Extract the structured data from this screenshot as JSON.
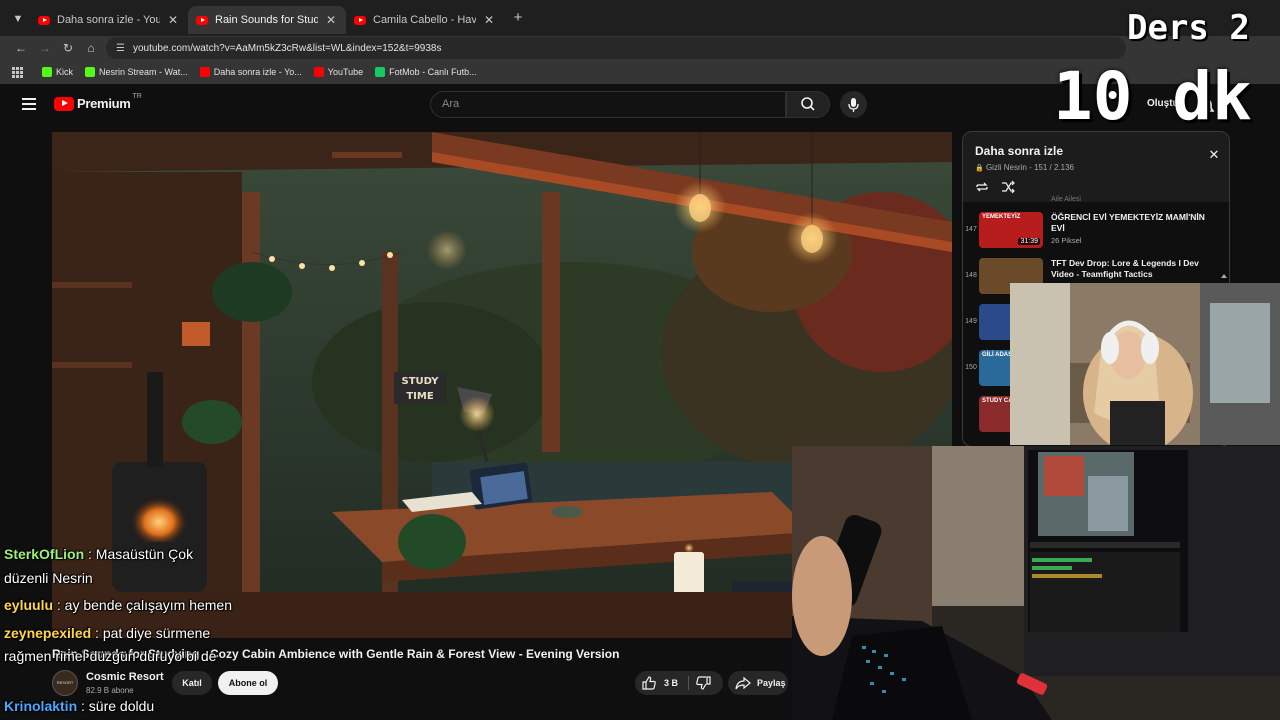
{
  "browser": {
    "tabs": [
      {
        "title": "Daha sonra izle - YouTube",
        "active": false
      },
      {
        "title": "Rain Sounds for Studying - Coz",
        "active": true
      },
      {
        "title": "Camila Cabello - Havana (Lyric",
        "active": false
      }
    ],
    "new_tab": "+",
    "url": "youtube.com/watch?v=AaMm5kZ3cRw&list=WL&index=152&t=9938s",
    "bookmarks": [
      {
        "label": "Kick",
        "color": "#53fc18"
      },
      {
        "label": "Nesrin Stream - Wat...",
        "color": "#53fc18"
      },
      {
        "label": "Daha sonra izle - Yo...",
        "color": "#ff0000"
      },
      {
        "label": "YouTube",
        "color": "#ff0000"
      },
      {
        "label": "FotMob - Canlı Futb...",
        "color": "#17c964"
      }
    ]
  },
  "youtube": {
    "logo_text": "Premium",
    "country": "TR",
    "search_placeholder": "Ara",
    "create_label": "Oluştur",
    "video": {
      "title": "Rain Sounds for Studying - Cozy Cabin Ambience with Gentle Rain & Forest View - Evening Version",
      "sign_line1": "STUDY",
      "sign_line2": "TIME",
      "channel_avatar_text": "RESORT",
      "channel_name": "Cosmic Resort",
      "channel_subs": "82.9 B abone",
      "join_label": "Katıl",
      "subscribe_label": "Abone ol",
      "like_count": "3 B",
      "share_label": "Paylaş"
    },
    "playlist": {
      "title": "Daha sonra izle",
      "meta": "Gizli Nesrin - 151 / 2.136",
      "cut_channel": "Aile Ailesi",
      "items": [
        {
          "index": "147",
          "title": "ÖĞRENCİ EVİ YEMEKTEYİZ MAMİ'NİN EVİ",
          "channel": "26 Piksel",
          "duration": "31:39",
          "thumb_text": "YEMEKTEYİZ",
          "thumb_color": "#b81d1d"
        },
        {
          "index": "148",
          "title": "TFT Dev Drop: Lore & Legends I Dev Video - Teamfight Tactics",
          "channel": "",
          "duration": "",
          "thumb_text": "",
          "thumb_color": "#6b4a2a"
        },
        {
          "index": "149",
          "title": "",
          "channel": "",
          "duration": "",
          "thumb_text": "",
          "thumb_color": "#2a4a8a"
        },
        {
          "index": "150",
          "title": "",
          "channel": "",
          "duration": "",
          "thumb_text": "GİLİ ADASI",
          "thumb_color": "#2a6a9a"
        },
        {
          "index": "",
          "title": "",
          "channel": "",
          "duration": "",
          "thumb_text": "STUDY CAR",
          "thumb_color": "#8a2a2a"
        }
      ]
    }
  },
  "overlay": {
    "ders_label": "Ders 2",
    "timer_label": "10 dk"
  },
  "chat": [
    {
      "user": "SterkOfLion",
      "color": "#9ef07a",
      "text": " : Masaüstün Çok",
      "cont": "düzenli Nesrin"
    },
    {
      "user": "eyluulu",
      "color": "#ffd84a",
      "text": " : ay bende çalışayım hemen",
      "cont": ""
    },
    {
      "user": "zeynepexiled",
      "color": "#ffd84a",
      "text": " : pat diye sürmene",
      "cont": "rağmen rimel düzgün duruyo bi de"
    },
    {
      "user": "Krinolaktin",
      "color": "#4aa8ff",
      "text": " : süre doldu",
      "cont": ""
    }
  ]
}
